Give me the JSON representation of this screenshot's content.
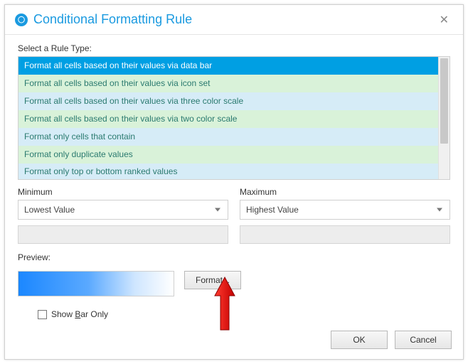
{
  "title": "Conditional Formatting Rule",
  "section_label": "Select a Rule Type:",
  "rule_types": [
    "Format all cells based on their values via data bar",
    "Format all cells based on their values via icon set",
    "Format all cells based on their values via three color scale",
    "Format all cells based on their values via two color scale",
    "Format only cells that contain",
    "Format only duplicate values",
    "Format only top or bottom ranked values"
  ],
  "min_label": "Minimum",
  "min_value": "Lowest Value",
  "max_label": "Maximum",
  "max_value": "Highest Value",
  "preview_label": "Preview:",
  "format_button": "Format...",
  "show_bar_label_pre": "Show ",
  "show_bar_label_ul": "B",
  "show_bar_label_post": "ar Only",
  "ok": "OK",
  "cancel": "Cancel"
}
